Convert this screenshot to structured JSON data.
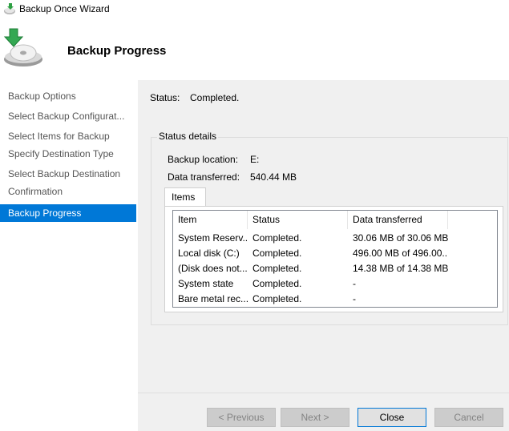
{
  "window": {
    "title": "Backup Once Wizard"
  },
  "header": {
    "title": "Backup Progress"
  },
  "sidebar": {
    "items": [
      {
        "label": "Backup Options",
        "active": false
      },
      {
        "label": "Select Backup Configurat...",
        "active": false
      },
      {
        "label": "Select Items for Backup",
        "active": false
      },
      {
        "label": "Specify Destination Type",
        "active": false
      },
      {
        "label": "Select Backup Destination",
        "active": false
      },
      {
        "label": "Confirmation",
        "active": false
      },
      {
        "label": "Backup Progress",
        "active": true
      }
    ]
  },
  "status": {
    "label": "Status:",
    "value": "Completed."
  },
  "details": {
    "legend": "Status details",
    "backup_location_label": "Backup location:",
    "backup_location_value": "E:",
    "data_transferred_label": "Data transferred:",
    "data_transferred_value": "540.44 MB"
  },
  "tabs": {
    "items_label": "Items"
  },
  "table": {
    "columns": [
      "Item",
      "Status",
      "Data transferred"
    ],
    "rows": [
      [
        "System Reserv...",
        "Completed.",
        "30.06 MB of 30.06 MB"
      ],
      [
        "Local disk (C:)",
        "Completed.",
        "496.00 MB of 496.00..."
      ],
      [
        "(Disk does not...",
        "Completed.",
        "14.38 MB of 14.38 MB"
      ],
      [
        "System state",
        "Completed.",
        "-"
      ],
      [
        "Bare metal rec...",
        "Completed.",
        "-"
      ]
    ]
  },
  "buttons": {
    "previous": "< Previous",
    "next": "Next >",
    "close": "Close",
    "cancel": "Cancel"
  },
  "colors": {
    "accent": "#0078d7",
    "content_bg": "#f0f0f0"
  }
}
